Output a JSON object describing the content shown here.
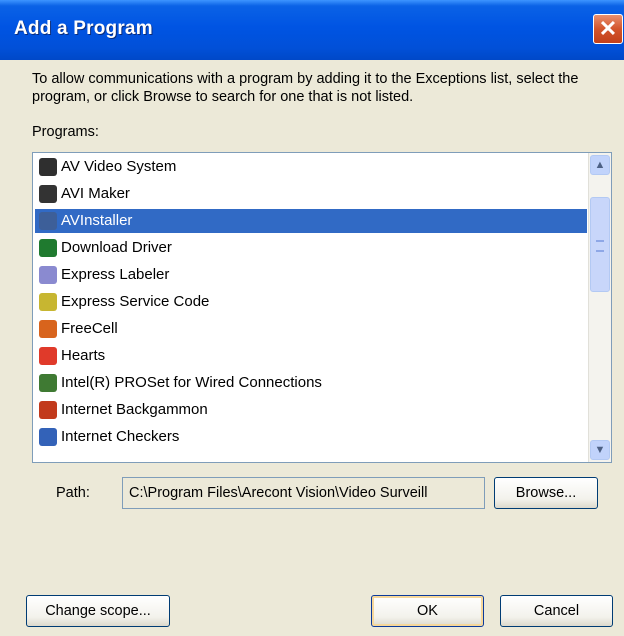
{
  "dialog": {
    "title": "Add a Program",
    "close_label": "✕",
    "description": "To allow communications with a program by adding it to the Exceptions list, select the program, or click Browse to search for one that is not listed.",
    "programs_label": "Programs:",
    "programs": [
      {
        "label": "AV Video System",
        "icon": "av-video-system-icon",
        "color": "#2f2f2f"
      },
      {
        "label": "AVI Maker",
        "icon": "avi-maker-icon",
        "color": "#333333"
      },
      {
        "label": "AVInstaller",
        "icon": "avinstaller-icon",
        "color": "#3d5f99",
        "selected": true
      },
      {
        "label": "Download Driver",
        "icon": "download-driver-icon",
        "color": "#1f7a2f"
      },
      {
        "label": "Express Labeler",
        "icon": "express-labeler-icon",
        "color": "#8a8ad0"
      },
      {
        "label": "Express Service Code",
        "icon": "express-service-code-icon",
        "color": "#c7b631"
      },
      {
        "label": "FreeCell",
        "icon": "freecell-icon",
        "color": "#d8641d"
      },
      {
        "label": "Hearts",
        "icon": "hearts-icon",
        "color": "#e03a2a"
      },
      {
        "label": "Intel(R) PROSet for Wired Connections",
        "icon": "intel-proset-icon",
        "color": "#3f7a33"
      },
      {
        "label": "Internet Backgammon",
        "icon": "internet-backgammon-icon",
        "color": "#c23a1c"
      },
      {
        "label": "Internet Checkers",
        "icon": "internet-checkers-icon",
        "color": "#3362b8"
      }
    ],
    "path_label": "Path:",
    "path_value": "C:\\Program Files\\Arecont Vision\\Video Surveill",
    "browse_label": "Browse...",
    "change_scope_label": "Change scope...",
    "ok_label": "OK",
    "cancel_label": "Cancel"
  }
}
